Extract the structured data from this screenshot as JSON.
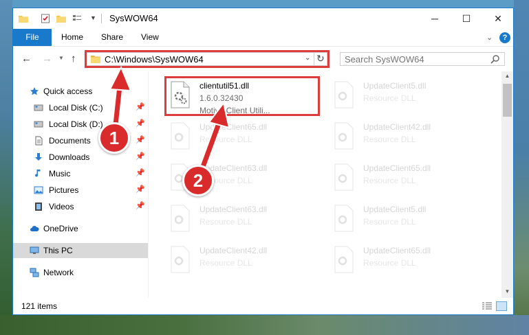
{
  "window": {
    "title": "SysWOW64",
    "controls": {
      "minimize": "─",
      "maximize": "☐",
      "close": "✕"
    }
  },
  "ribbon": {
    "tabs": [
      "File",
      "Home",
      "Share",
      "View"
    ],
    "help": "?"
  },
  "address": {
    "path": "C:\\Windows\\SysWOW64",
    "search_placeholder": "Search SysWOW64"
  },
  "nav": {
    "quick_access": "Quick access",
    "pinned": [
      {
        "label": "Local Disk (C:)",
        "icon": "drive-icon"
      },
      {
        "label": "Local Disk (D:)",
        "icon": "drive-icon"
      },
      {
        "label": "Documents",
        "icon": "documents-icon"
      },
      {
        "label": "Downloads",
        "icon": "downloads-icon"
      },
      {
        "label": "Music",
        "icon": "music-icon"
      },
      {
        "label": "Pictures",
        "icon": "pictures-icon"
      },
      {
        "label": "Videos",
        "icon": "videos-icon"
      }
    ],
    "onedrive": "OneDrive",
    "this_pc": "This PC",
    "network": "Network"
  },
  "files": [
    {
      "name": "clientutil51.dll",
      "version": "1.6.0.32430",
      "description": "Motive Client Utili..."
    },
    {
      "name": "UpdateClient5.dll",
      "type": "Resource DLL"
    },
    {
      "name": "UpdateClient65.dll",
      "type": "Resource DLL"
    },
    {
      "name": "UpdateClient42.dll",
      "type": "Resource DLL"
    },
    {
      "name": "UpdateClient63.dll",
      "type": "Resource DLL"
    },
    {
      "name": "UpdateClient65.dll",
      "type": "Resource DLL"
    },
    {
      "name": "UpdateClient63.dll",
      "type": "Resource DLL"
    },
    {
      "name": "UpdateClient5.dll",
      "type": "Resource DLL"
    },
    {
      "name": "UpdateClient42.dll",
      "type": "Resource DLL"
    },
    {
      "name": "UpdateClient65.dll",
      "type": "Resource DLL"
    }
  ],
  "status": {
    "items": "121 items"
  },
  "annotations": {
    "marker_1": "1",
    "marker_2": "2"
  },
  "colors": {
    "accent": "#1979ca",
    "highlight": "#dc3c3c",
    "selected": "#d9d9d9"
  }
}
